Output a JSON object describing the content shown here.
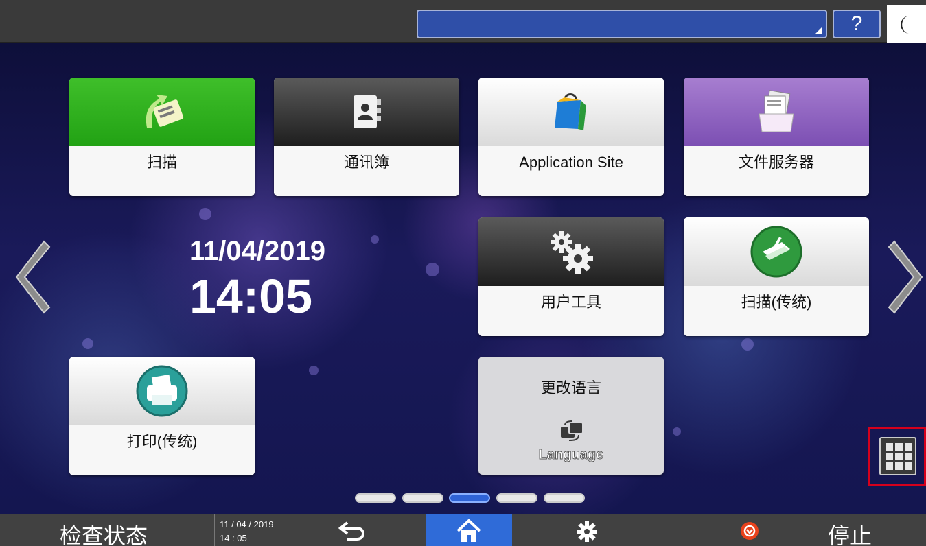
{
  "topbar": {
    "help_label": "?"
  },
  "tiles": {
    "scan": "扫描",
    "address_book": "通讯簿",
    "application_site": "Application Site",
    "file_server": "文件服务器",
    "user_tools": "用户工具",
    "scan_classic": "扫描(传统)",
    "print_classic": "打印(传统)",
    "change_language": "更改语言",
    "language": "Language"
  },
  "clock": {
    "date": "11/04/2019",
    "time": "14:05"
  },
  "pagination": {
    "pages": 5,
    "active_page": 3
  },
  "bottombar": {
    "check_status": "检查状态",
    "date": "11 / 04 / 2019",
    "time": "14 : 05",
    "stop": "停止"
  },
  "colors": {
    "accent_blue": "#2f63d6",
    "scan_green": "#22a214",
    "stop_red": "#e8421c",
    "highlight_red": "#d6001c"
  }
}
